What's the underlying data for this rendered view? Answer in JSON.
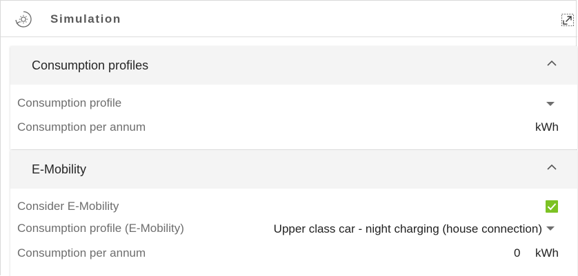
{
  "widget": {
    "title": "Simulation",
    "icon": "sun-cycle-icon",
    "expand_icon": "expand-icon"
  },
  "panels": [
    {
      "title": "Consumption profiles",
      "expanded": true,
      "rows": [
        {
          "label": "Consumption profile",
          "value": "",
          "control": "dropdown"
        },
        {
          "label": "Consumption per annum",
          "value": "",
          "unit": "kWh"
        }
      ]
    },
    {
      "title": "E-Mobility",
      "expanded": true,
      "rows": [
        {
          "label": "Consider E-Mobility",
          "checked": true,
          "control": "checkbox"
        },
        {
          "label": "Consumption profile (E-Mobility)",
          "value": "Upper class car - night charging (house connection)",
          "control": "dropdown"
        },
        {
          "label": "Consumption per annum",
          "value": "0",
          "unit": "kWh"
        }
      ]
    }
  ],
  "colors": {
    "checkbox_checked": "#7cc224",
    "panel_header_bg": "#f4f4f4",
    "label_text": "#6e6e6e",
    "value_text": "#212121"
  }
}
